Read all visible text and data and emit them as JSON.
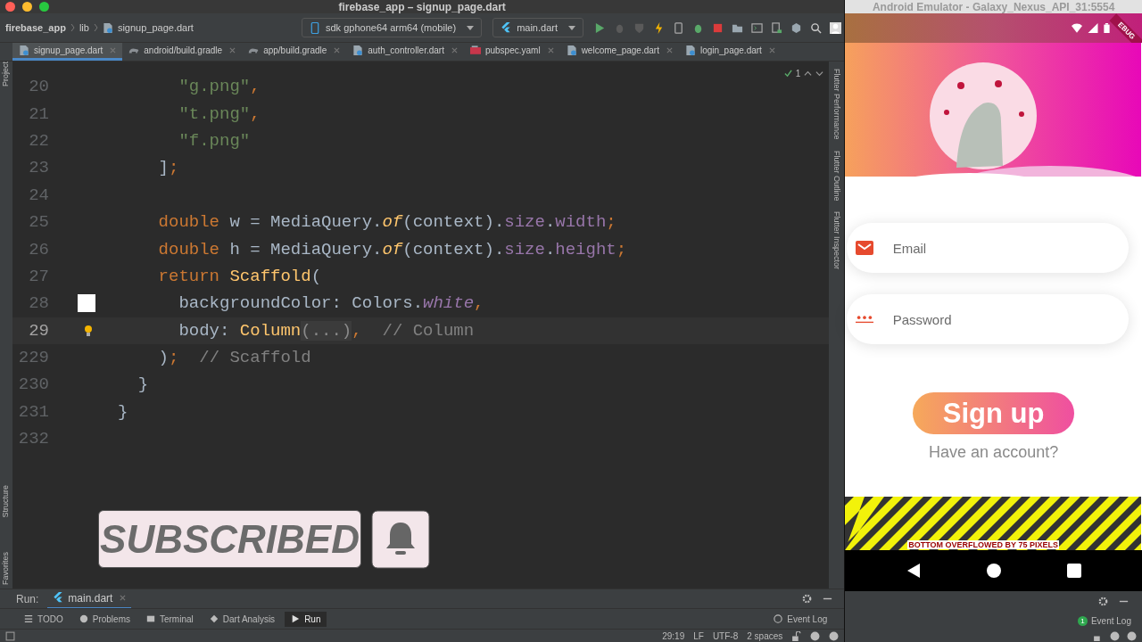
{
  "window": {
    "title": "firebase_app – signup_page.dart"
  },
  "breadcrumb": [
    "firebase_app",
    "lib",
    "signup_page.dart"
  ],
  "device_selector": "sdk gphone64 arm64 (mobile)",
  "run_config": "main.dart",
  "left_side_tabs": [
    {
      "label": "Project"
    },
    {
      "label": "Structure"
    },
    {
      "label": "Favorites"
    }
  ],
  "right_side_tabs": [
    {
      "label": "Flutter Performance"
    },
    {
      "label": "Flutter Outline"
    },
    {
      "label": "Flutter Inspector"
    }
  ],
  "editor_tabs": [
    {
      "label": "signup_page.dart",
      "kind": "dart",
      "selected": true
    },
    {
      "label": "android/build.gradle",
      "kind": "gradle",
      "selected": false
    },
    {
      "label": "app/build.gradle",
      "kind": "gradle",
      "selected": false
    },
    {
      "label": "auth_controller.dart",
      "kind": "dart",
      "selected": false
    },
    {
      "label": "pubspec.yaml",
      "kind": "yaml",
      "selected": false
    },
    {
      "label": "welcome_page.dart",
      "kind": "dart",
      "selected": false
    },
    {
      "label": "login_page.dart",
      "kind": "dart",
      "selected": false
    }
  ],
  "editor": {
    "inspection_count": "1",
    "lines": [
      {
        "number": "20",
        "current": false,
        "tokens": [
          {
            "kind": "str",
            "text": "      \"g.png\""
          },
          {
            "kind": "punct",
            "text": ","
          }
        ]
      },
      {
        "number": "21",
        "current": false,
        "tokens": [
          {
            "kind": "str",
            "text": "      \"t.png\""
          },
          {
            "kind": "punct",
            "text": ","
          }
        ]
      },
      {
        "number": "22",
        "current": false,
        "tokens": [
          {
            "kind": "str",
            "text": "      \"f.png\""
          }
        ]
      },
      {
        "number": "23",
        "current": false,
        "tokens": [
          {
            "kind": "plain",
            "text": "    ]"
          },
          {
            "kind": "punct",
            "text": ";"
          }
        ]
      },
      {
        "number": "24",
        "current": false
      },
      {
        "number": "25",
        "current": false,
        "tokens": [
          {
            "kind": "kw",
            "text": "    double "
          },
          {
            "kind": "plain",
            "text": "w = MediaQuery."
          },
          {
            "kind": "method",
            "text": "of"
          },
          {
            "kind": "plain",
            "text": "(context)."
          },
          {
            "kind": "field",
            "text": "size"
          },
          {
            "kind": "plain",
            "text": "."
          },
          {
            "kind": "field",
            "text": "width"
          },
          {
            "kind": "punct",
            "text": ";"
          }
        ]
      },
      {
        "number": "26",
        "current": false,
        "tokens": [
          {
            "kind": "kw",
            "text": "    double "
          },
          {
            "kind": "plain",
            "text": "h = MediaQuery."
          },
          {
            "kind": "method",
            "text": "of"
          },
          {
            "kind": "plain",
            "text": "(context)."
          },
          {
            "kind": "field",
            "text": "size"
          },
          {
            "kind": "plain",
            "text": "."
          },
          {
            "kind": "field",
            "text": "height"
          },
          {
            "kind": "punct",
            "text": ";"
          }
        ]
      },
      {
        "number": "27",
        "current": false,
        "tokens": [
          {
            "kind": "kw",
            "text": "    return "
          },
          {
            "kind": "cls",
            "text": "Scaffold"
          },
          {
            "kind": "plain",
            "text": "("
          }
        ]
      },
      {
        "number": "28",
        "current": false,
        "tokens": [
          {
            "kind": "plain",
            "text": "      backgroundColor: Colors."
          },
          {
            "kind": "const",
            "text": "white"
          },
          {
            "kind": "punct",
            "text": ","
          }
        ]
      },
      {
        "number": "29",
        "current": true,
        "tokens": [
          {
            "kind": "plain",
            "text": "      body: "
          },
          {
            "kind": "cls",
            "text": "Column"
          },
          {
            "kind": "fold",
            "text": "(...)"
          },
          {
            "kind": "punct",
            "text": ","
          },
          {
            "kind": "comment",
            "text": "  // Column"
          }
        ]
      },
      {
        "number": "229",
        "current": false,
        "tokens": [
          {
            "kind": "plain",
            "text": "    )"
          },
          {
            "kind": "punct",
            "text": ";"
          },
          {
            "kind": "comment",
            "text": "  // Scaffold"
          }
        ]
      },
      {
        "number": "230",
        "current": false,
        "tokens": [
          {
            "kind": "plain",
            "text": "  }"
          }
        ]
      },
      {
        "number": "231",
        "current": false,
        "tokens": [
          {
            "kind": "plain",
            "text": "}"
          }
        ]
      },
      {
        "number": "232",
        "current": false
      }
    ]
  },
  "overlay": {
    "label": "SUBSCRIBED"
  },
  "run_panel": {
    "label": "Run:",
    "tab": "main.dart"
  },
  "tool_windows": [
    {
      "label": "TODO",
      "kind": "list",
      "selected": false
    },
    {
      "label": "Problems",
      "kind": "problems",
      "selected": false
    },
    {
      "label": "Terminal",
      "kind": "terminal",
      "selected": false
    },
    {
      "label": "Dart Analysis",
      "kind": "analysis",
      "selected": false
    },
    {
      "label": "Run",
      "kind": "run",
      "selected": true
    }
  ],
  "event_log": "Event Log",
  "status_bar": [
    "29:19",
    "LF",
    "UTF-8",
    "2 spaces"
  ],
  "emulator": {
    "title": "Android Emulator - Galaxy_Nexus_API_31:5554",
    "debug_banner": "EBUG",
    "fields": [
      {
        "placeholder": "Email",
        "kind": "email"
      },
      {
        "placeholder": "Password",
        "kind": "password"
      }
    ],
    "button": "Sign up",
    "link": "Have an account?",
    "overflow_message": "BOTTOM OVERFLOWED BY 75 PIXELS",
    "event_count": "1",
    "event_log": "Event Log"
  }
}
